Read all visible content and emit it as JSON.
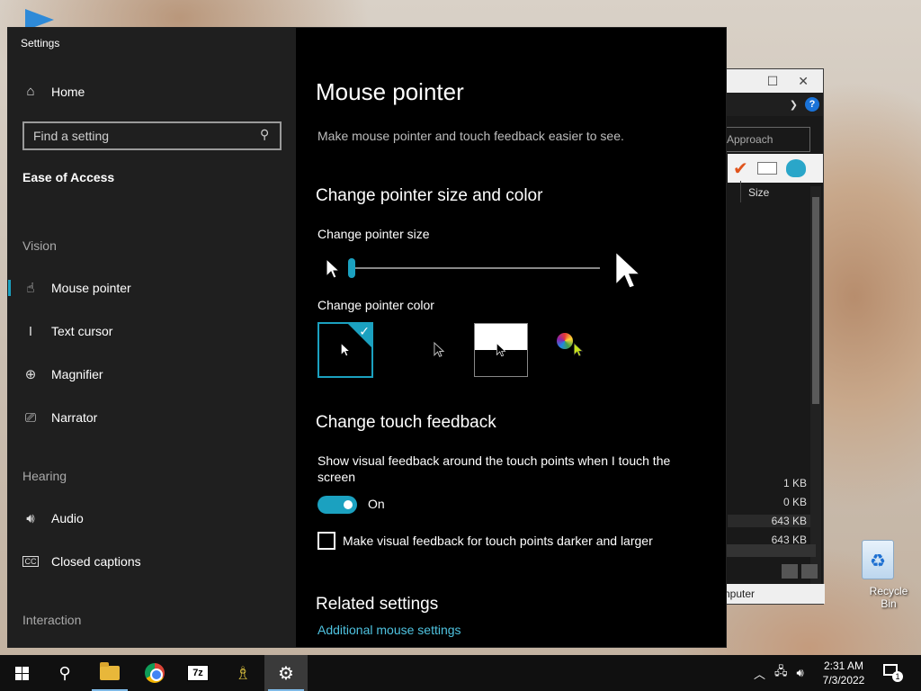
{
  "settings": {
    "window_title": "Settings",
    "home_label": "Home",
    "search_placeholder": "Find a setting",
    "current_section": "Ease of Access",
    "groups": {
      "vision": "Vision",
      "hearing": "Hearing",
      "interaction": "Interaction"
    },
    "nav": {
      "mouse_pointer": "Mouse pointer",
      "text_cursor": "Text cursor",
      "magnifier": "Magnifier",
      "narrator": "Narrator",
      "audio": "Audio",
      "closed_captions": "Closed captions"
    }
  },
  "content": {
    "title": "Mouse pointer",
    "description": "Make mouse pointer and touch feedback easier to see.",
    "size_color_heading": "Change pointer size and color",
    "pointer_size_label": "Change pointer size",
    "pointer_size_value": 0.0,
    "pointer_color_label": "Change pointer color",
    "pointer_color_options": [
      "white",
      "black",
      "inverted",
      "custom"
    ],
    "pointer_color_selected": "white",
    "touch_heading": "Change touch feedback",
    "touch_desc": "Show visual feedback around the touch points when I touch the screen",
    "touch_toggle_state": "On",
    "darker_checkbox_label": "Make visual feedback for touch points darker and larger",
    "darker_checkbox_checked": false,
    "related_heading": "Related settings",
    "related_link": "Additional mouse settings"
  },
  "explorer": {
    "search_placeholder": "Approach",
    "column_size": "Size",
    "sizes": [
      "1 KB",
      "0 KB",
      "643 KB",
      "643 KB"
    ],
    "status": "nputer",
    "help": "?"
  },
  "desktop": {
    "recycle_bin": "Recycle Bin"
  },
  "taskbar": {
    "time": "2:31 AM",
    "date": "7/3/2022",
    "sevenzip_label": "7z",
    "notification_count": "1"
  },
  "colors": {
    "accent": "#1ba1c0",
    "link": "#4fc3e0",
    "sidebar_bg": "#1f1f1f",
    "content_bg": "#000000"
  }
}
